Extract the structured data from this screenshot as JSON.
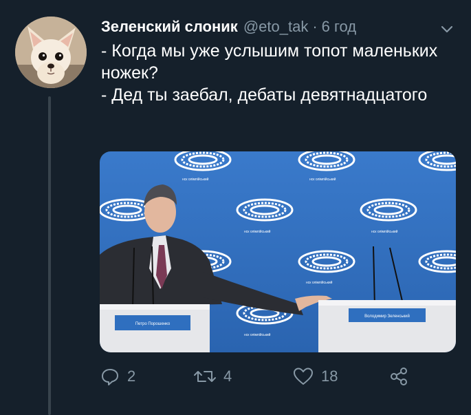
{
  "author": {
    "display_name": "Зеленский слоник",
    "handle": "@eto_tak",
    "separator": "·",
    "time": "6 год",
    "avatar_icon": "chihuahua-avatar"
  },
  "tweet": {
    "lines": [
      "- Когда мы уже услышим топот маленьких ножек?",
      "- Дед ты заебал, дебаты девятнадцатого"
    ]
  },
  "media": {
    "backdrop_label": "нск олімпійський",
    "podium_left_label": "Петро Порошенко",
    "podium_right_label": "Володимир Зеленський"
  },
  "actions": {
    "reply_count": "2",
    "retweet_count": "4",
    "like_count": "18",
    "icons": [
      "reply-icon",
      "retweet-icon",
      "like-icon",
      "share-icon"
    ]
  },
  "colors": {
    "background": "#15202b",
    "secondary_text": "#8899a6",
    "thread_line": "#38444d",
    "backdrop_blue": "#2f6fbf"
  }
}
